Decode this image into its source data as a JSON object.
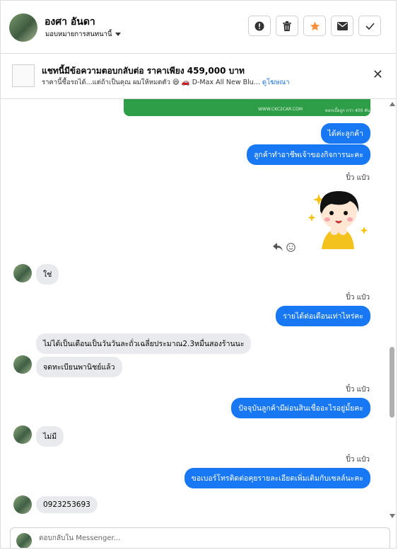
{
  "header": {
    "name": "องศา อันดา",
    "assign_label": "มอบหมายการสนทนานี้",
    "actions": [
      "alert-icon",
      "trash-icon",
      "star-icon",
      "mail-icon",
      "check-icon"
    ]
  },
  "ad": {
    "title": "แชทนี้มีข้อความตอบกลับต่อ ราคาเพียง 459,000 บาท",
    "subtitle": "ราคานี้ซื้อรถได้...แต่ถ้าเป็นคุณ ผมให้หมดตัว 😆 🚗 D-Max All New Blu...",
    "link": "ดูโฆษณา"
  },
  "banner": {
    "url": "WWW.CKC2CAR.COM",
    "right_text": "ดอกเบี้ยถูก กว่า 400 คัน"
  },
  "messages": [
    {
      "dir": "out",
      "text": "ได้ค่ะลูกค้า"
    },
    {
      "dir": "out",
      "text": "ลูกค้าทำอาชีพเจ้าของกิจการนะคะ"
    },
    {
      "dir": "sender",
      "text": "ปิ๋ว แป๋ว"
    },
    {
      "dir": "in",
      "text": "ใช่"
    },
    {
      "dir": "sender",
      "text": "ปิ๋ว แป๋ว"
    },
    {
      "dir": "out",
      "text": "รายได้ต่อเดือนเท่าไหร่คะ"
    },
    {
      "dir": "in",
      "text": "ไม่ได้เป็นเดือนเป็นวันวันละถั่วเฉลี่ยประมาณ2.3หมื่นสองร้านนะ"
    },
    {
      "dir": "in",
      "text": "จดทะเบียนพานิชย์แล้ว"
    },
    {
      "dir": "sender",
      "text": "ปิ๋ว แป๋ว"
    },
    {
      "dir": "out",
      "text": "ปัจจุบันลูกค้ามีผ่อนสินเชื่ออะไรอยู่มั้ยคะ"
    },
    {
      "dir": "in",
      "text": "ไม่มี"
    },
    {
      "dir": "sender",
      "text": "ปิ๋ว แป๋ว"
    },
    {
      "dir": "out",
      "text": "ขอเบอร์โทรติดต่อคุยรายละเอียดเพิ่มเติมกับเซลล์นะคะ"
    },
    {
      "dir": "in",
      "text": "0923253693"
    }
  ],
  "composer": {
    "placeholder": "ตอบกลับใน Messenger..."
  }
}
